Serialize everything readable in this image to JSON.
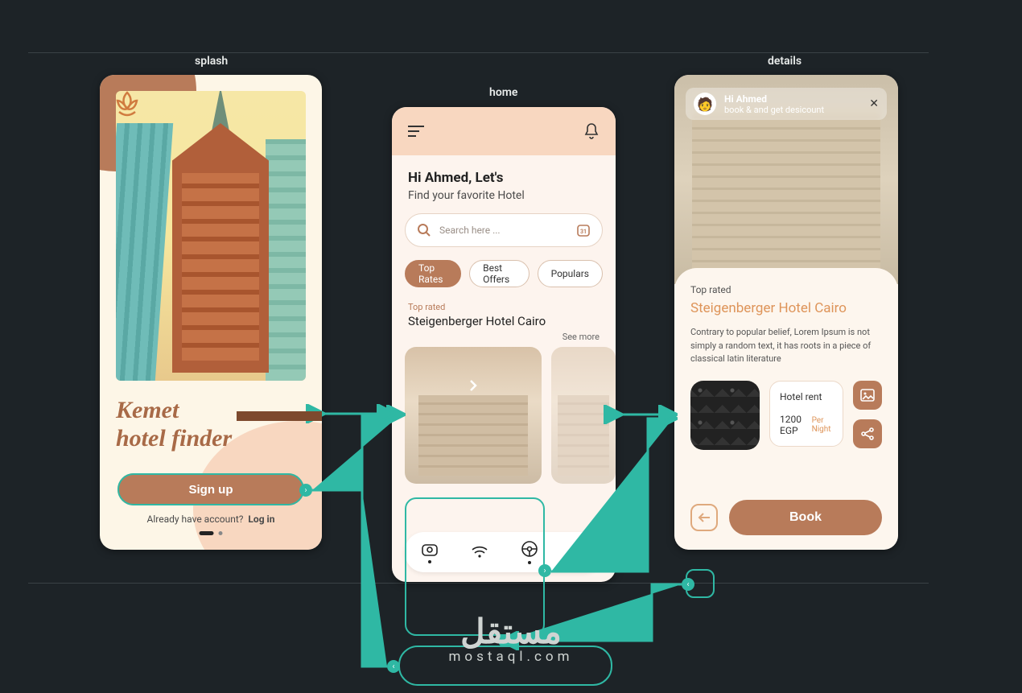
{
  "labels": {
    "splash": "splash",
    "home": "home",
    "details": "details"
  },
  "splash": {
    "brand_line1": "Kemet",
    "brand_line2": "hotel finder",
    "signup": "Sign up",
    "already": "Already have account?",
    "login": "Log in"
  },
  "home": {
    "greeting": "Hi Ahmed, Let's",
    "subtitle": "Find your favorite Hotel",
    "search_placeholder": "Search here ...",
    "chips": [
      "Top Rates",
      "Best Offers",
      "Populars"
    ],
    "section_label": "Top rated",
    "hotel_name": "Steigenberger Hotel Cairo",
    "see_more": "See more"
  },
  "details": {
    "toast_greeting": "Hi Ahmed",
    "toast_sub": "book & and get desicount",
    "section_label": "Top rated",
    "hotel_name": "Steigenberger Hotel Cairo",
    "description": "Contrary to popular belief, Lorem Ipsum is not simply a random text, it has roots in a piece of classical latin literature",
    "rent_label": "Hotel rent",
    "price": "1200 EGP",
    "per": "Per Night",
    "book": "Book"
  },
  "footer": {
    "arabic": "مستقل",
    "latin": "mostaql.com"
  }
}
